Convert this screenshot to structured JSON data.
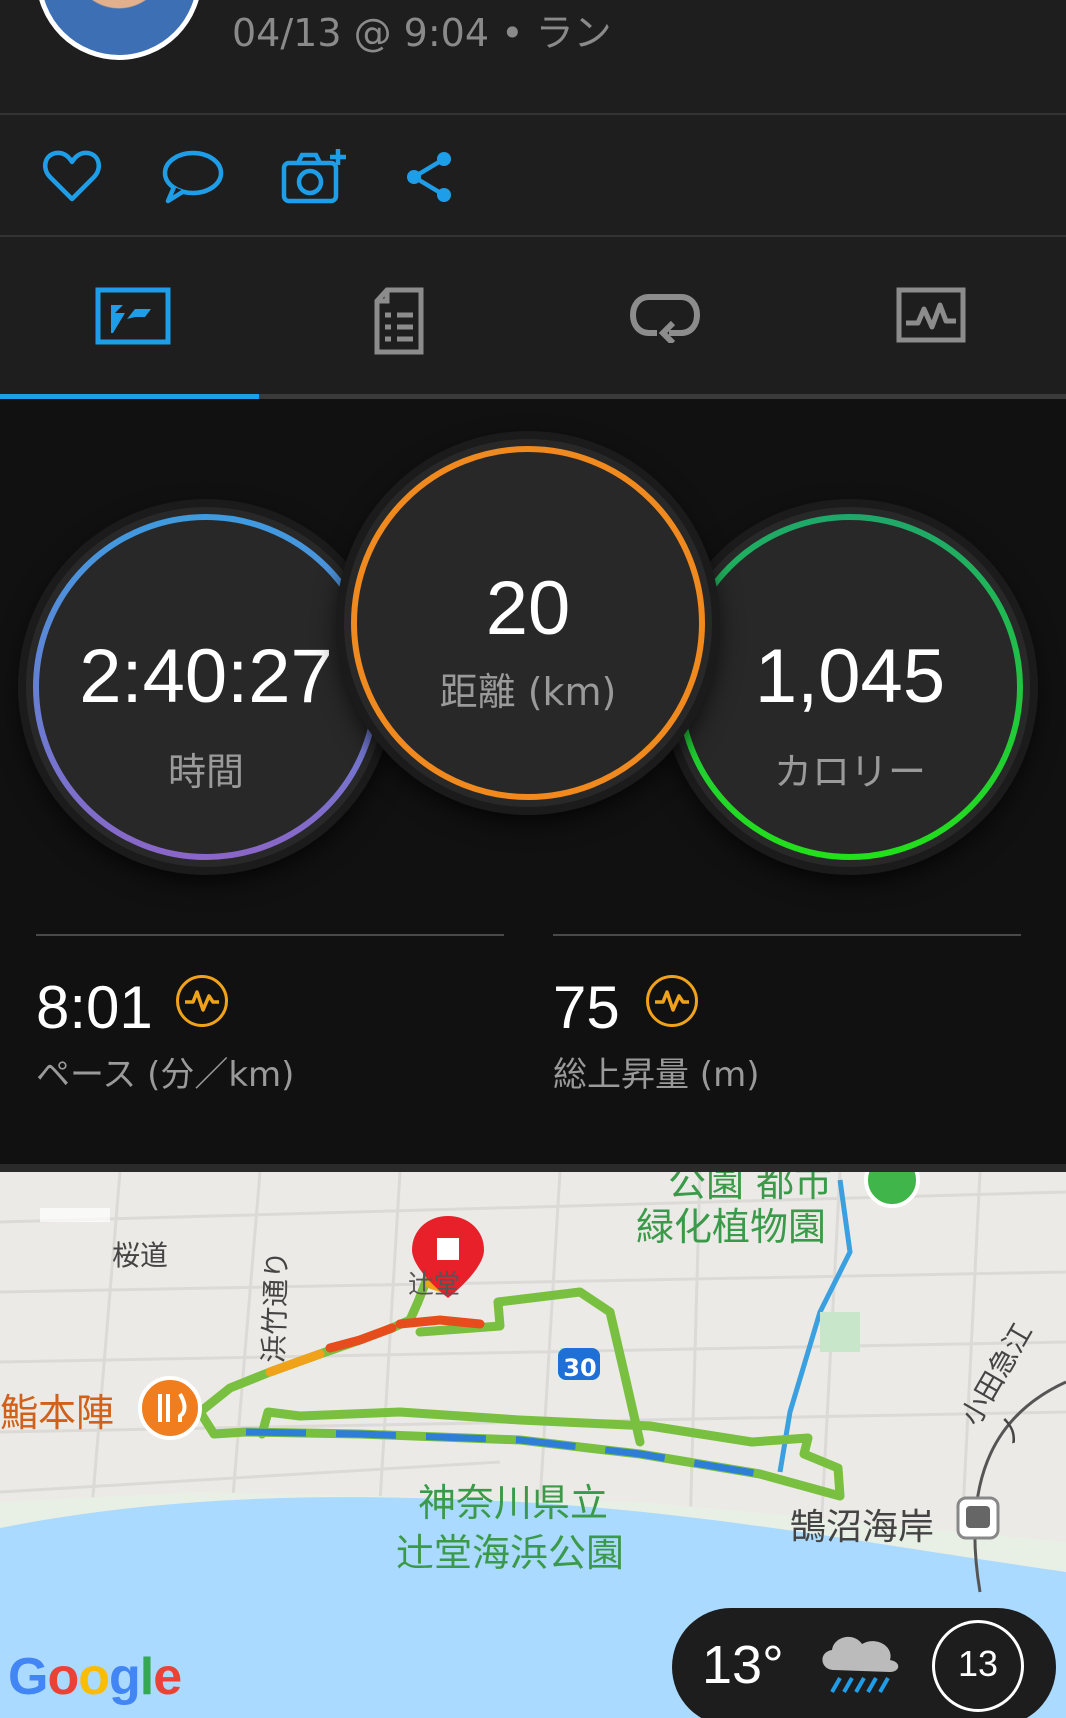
{
  "header": {
    "meta": "04/13 @ 9:04 • ラン"
  },
  "actions": [
    "heart-icon",
    "comment-icon",
    "add-photo-icon",
    "share-icon"
  ],
  "tabs": [
    "overview-icon",
    "list-icon",
    "laps-icon",
    "chart-icon"
  ],
  "colors": {
    "accent": "#1e9ee8",
    "time_ring": "#4a8fd6",
    "distance_ring": "#f08a1e",
    "calorie_ring": "#1fd62a",
    "badge": "#f0a21a"
  },
  "stats": {
    "time": {
      "value": "2:40:27",
      "label": "時間"
    },
    "distance": {
      "value": "20",
      "label": "距離 (km)"
    },
    "calories": {
      "value": "1,045",
      "label": "カロリー"
    },
    "pace": {
      "value": "8:01",
      "label": "ペース (分／km)"
    },
    "elevation": {
      "value": "75",
      "label": "総上昇量 (m)"
    }
  },
  "map": {
    "labels": {
      "sakuramichi": "桜道",
      "park_top": "公園 都市",
      "botanical": "緑化植物園",
      "hamatake": "浜竹通り",
      "sushi": "鮨本陣",
      "route30": "30",
      "kanagawa": "神奈川県立",
      "tsujido": "辻堂海浜公園",
      "kugenuma": "鵠沼海岸",
      "odakyu": "小田急江ノ",
      "endpoint": "辻堂"
    },
    "google": "Google"
  },
  "weather": {
    "temperature": "13°",
    "wind": "13"
  }
}
